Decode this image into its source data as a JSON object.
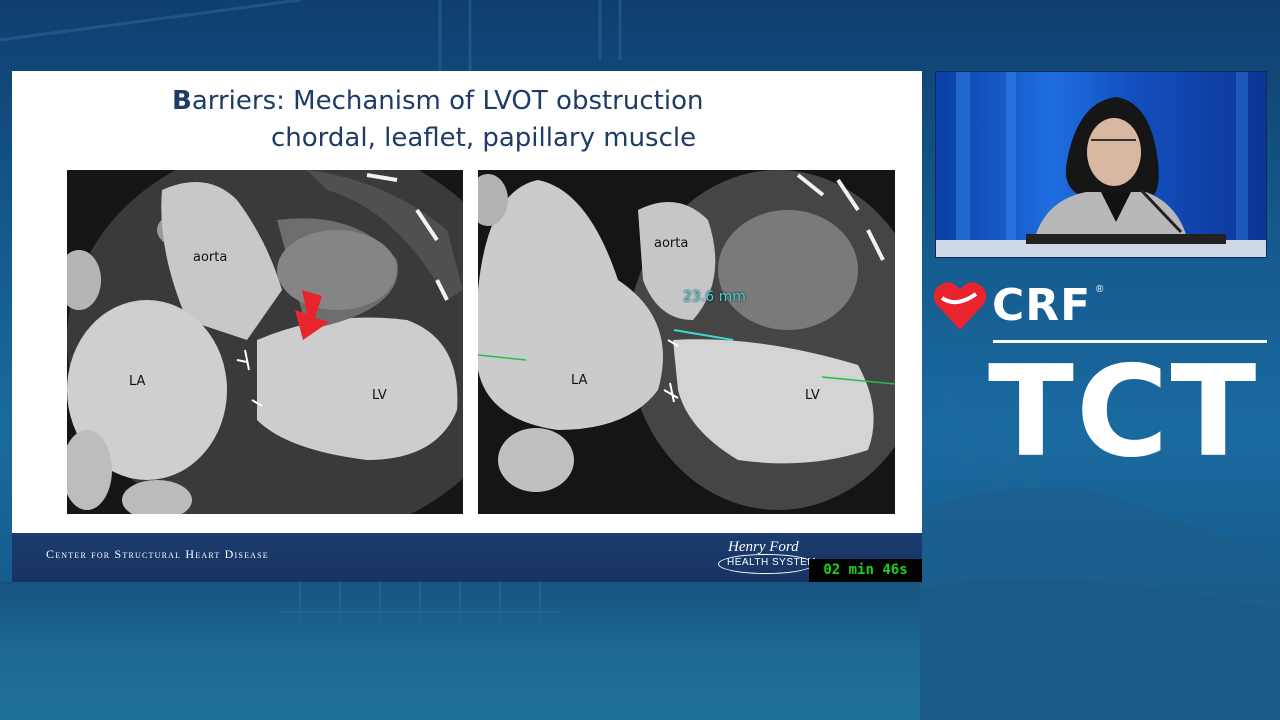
{
  "slide": {
    "title_initial": "B",
    "title_rest": "arriers: Mechanism of LVOT obstruction",
    "subtitle": "chordal, leaflet, papillary muscle",
    "left_image_labels": {
      "aorta": "aorta",
      "la": "LA",
      "lv": "LV"
    },
    "right_image_labels": {
      "aorta": "aorta",
      "la": "LA",
      "lv": "LV",
      "measurement": "23.6 mm"
    },
    "footer_text": "Center for Structural Heart Disease",
    "logo_script": "Henry Ford",
    "logo_sub": "HEALTH SYSTEM",
    "timer": "02 min 46s"
  },
  "brand": {
    "crf": "CRF",
    "registered": "®",
    "tct": "TCT"
  },
  "icons": {
    "crf_logo": "heart-logo-icon",
    "arrow": "red-arrow-icon"
  },
  "colors": {
    "brand_red": "#e8242c",
    "title_navy": "#1e3c66",
    "footer_navy": "#173463",
    "timer_green": "#1ed01e",
    "measure_cyan": "#3fd6d6"
  }
}
